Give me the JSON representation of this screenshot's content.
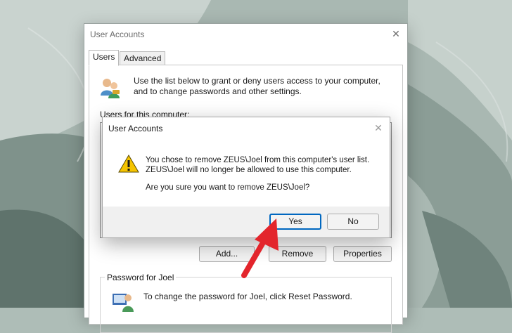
{
  "main_window": {
    "title": "User Accounts",
    "tabs": [
      "Users",
      "Advanced"
    ],
    "info_text_line1": "Use the list below to grant or deny users access to your computer,",
    "info_text_line2": "and to change passwords and other settings.",
    "users_label": "Users for this computer:",
    "buttons": {
      "add": "Add...",
      "remove": "Remove",
      "properties": "Properties"
    },
    "password_group": {
      "legend": "Password for Joel",
      "text": "To change the password for Joel, click Reset Password."
    }
  },
  "dialog": {
    "title": "User Accounts",
    "message_line1": "You chose to remove ZEUS\\Joel from this computer's user list.",
    "message_line2": "ZEUS\\Joel will no longer be allowed to use this computer.",
    "question": "Are you sure you want to remove ZEUS\\Joel?",
    "yes_label": "Yes",
    "no_label": "No"
  },
  "colors": {
    "accent": "#0067c0",
    "arrow": "#e3252c",
    "warning": "#f5c400"
  },
  "icons": {
    "close": "close-icon",
    "warning": "warning-icon",
    "users": "users-icon",
    "password": "password-user-icon"
  }
}
